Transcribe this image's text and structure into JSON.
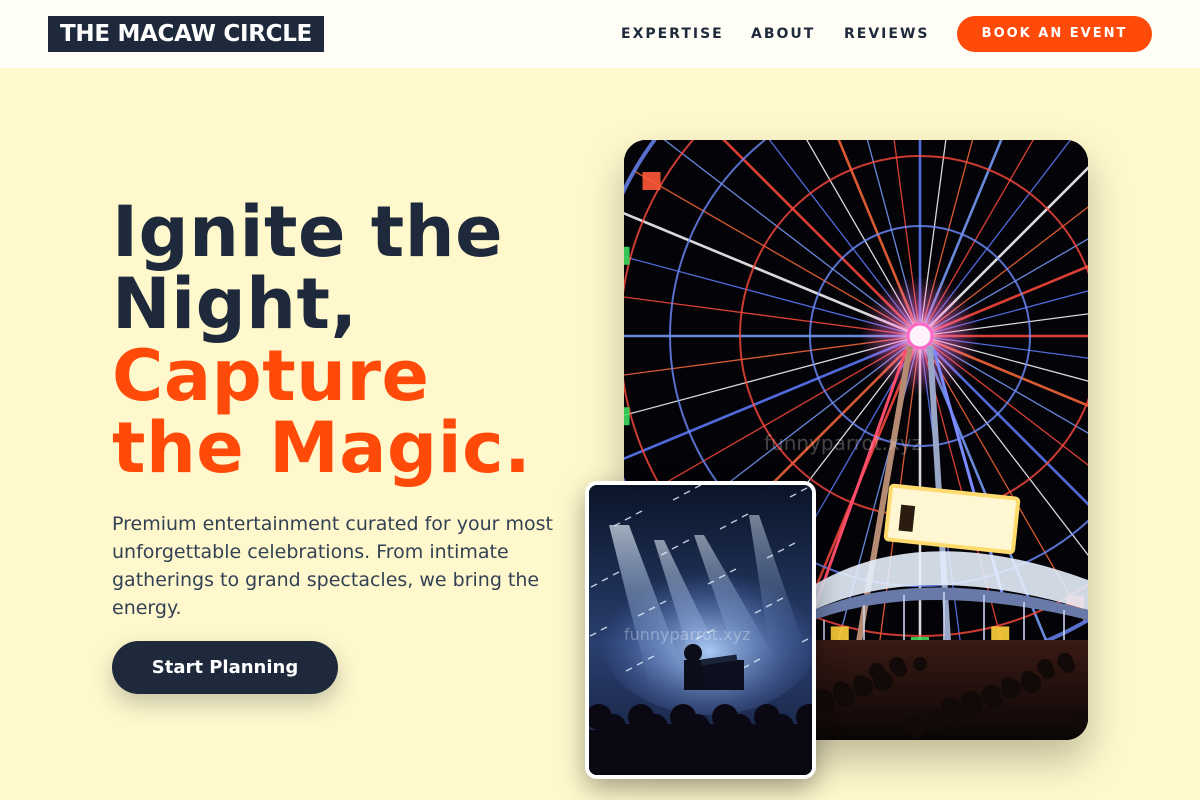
{
  "brand": {
    "logo_text": "THE MACAW CIRCLE"
  },
  "nav": {
    "items": [
      "EXPERTISE",
      "ABOUT",
      "REVIEWS"
    ],
    "cta_label": "BOOK AN EVENT"
  },
  "hero": {
    "headline_lines": [
      "Ignite the",
      "Night,"
    ],
    "accent_lines": [
      "Capture",
      "the Magic."
    ],
    "description": "Premium entertainment curated for your most unforgettable celebrations. From intimate gatherings to grand spectacles, we bring the energy.",
    "cta_label": "Start Planning"
  },
  "images": {
    "main": {
      "subject": "illuminated ferris wheel at night",
      "watermark": "funnyparrot.xyz"
    },
    "secondary": {
      "subject": "concert stage with spotlights and crowd",
      "watermark": "funnyparrot.xyz"
    }
  },
  "colors": {
    "accent": "#ff4a0a",
    "navy": "#1e293b",
    "background": "#fff8cc"
  }
}
